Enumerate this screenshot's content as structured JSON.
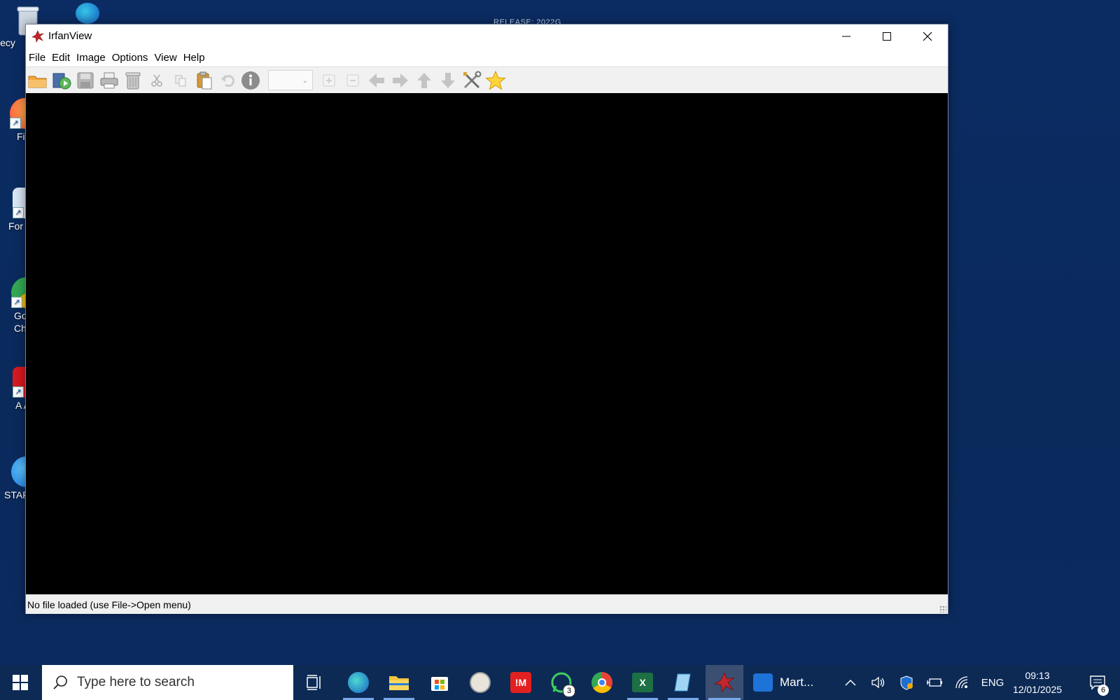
{
  "desktop": {
    "release_text": "RELEASE: 2022G",
    "icons": [
      {
        "label": "Recy"
      },
      {
        "label": "Fi"
      },
      {
        "label": "For"
      },
      {
        "label": "Go Ch"
      },
      {
        "label": "A Ac"
      },
      {
        "label": "STAR"
      }
    ]
  },
  "window": {
    "title": "IrfanView",
    "menu": [
      "File",
      "Edit",
      "Image",
      "Options",
      "View",
      "Help"
    ],
    "toolbar_icons": [
      "open-folder-icon",
      "slideshow-icon",
      "save-icon",
      "print-icon",
      "delete-icon",
      "cut-icon",
      "copy-icon",
      "paste-icon",
      "undo-icon",
      "info-icon",
      "zoom-in-icon",
      "zoom-out-icon",
      "previous-icon",
      "next-icon",
      "up-icon",
      "down-icon",
      "settings-tools-icon",
      "favorite-star-icon"
    ],
    "zoom_value": "",
    "status_text": "No file loaded (use File->Open menu)"
  },
  "taskbar": {
    "search_placeholder": "Type here to search",
    "whatsapp_badge": "3",
    "martin_label": "Mart...",
    "language": "ENG",
    "time": "09:13",
    "date": "12/01/2025",
    "notification_count": "6"
  },
  "colors": {
    "desktop_bg": "#0b2c63",
    "taskbar_bg": "#0d2a55",
    "canvas_bg": "#000000",
    "accent": "#77a8e8"
  }
}
